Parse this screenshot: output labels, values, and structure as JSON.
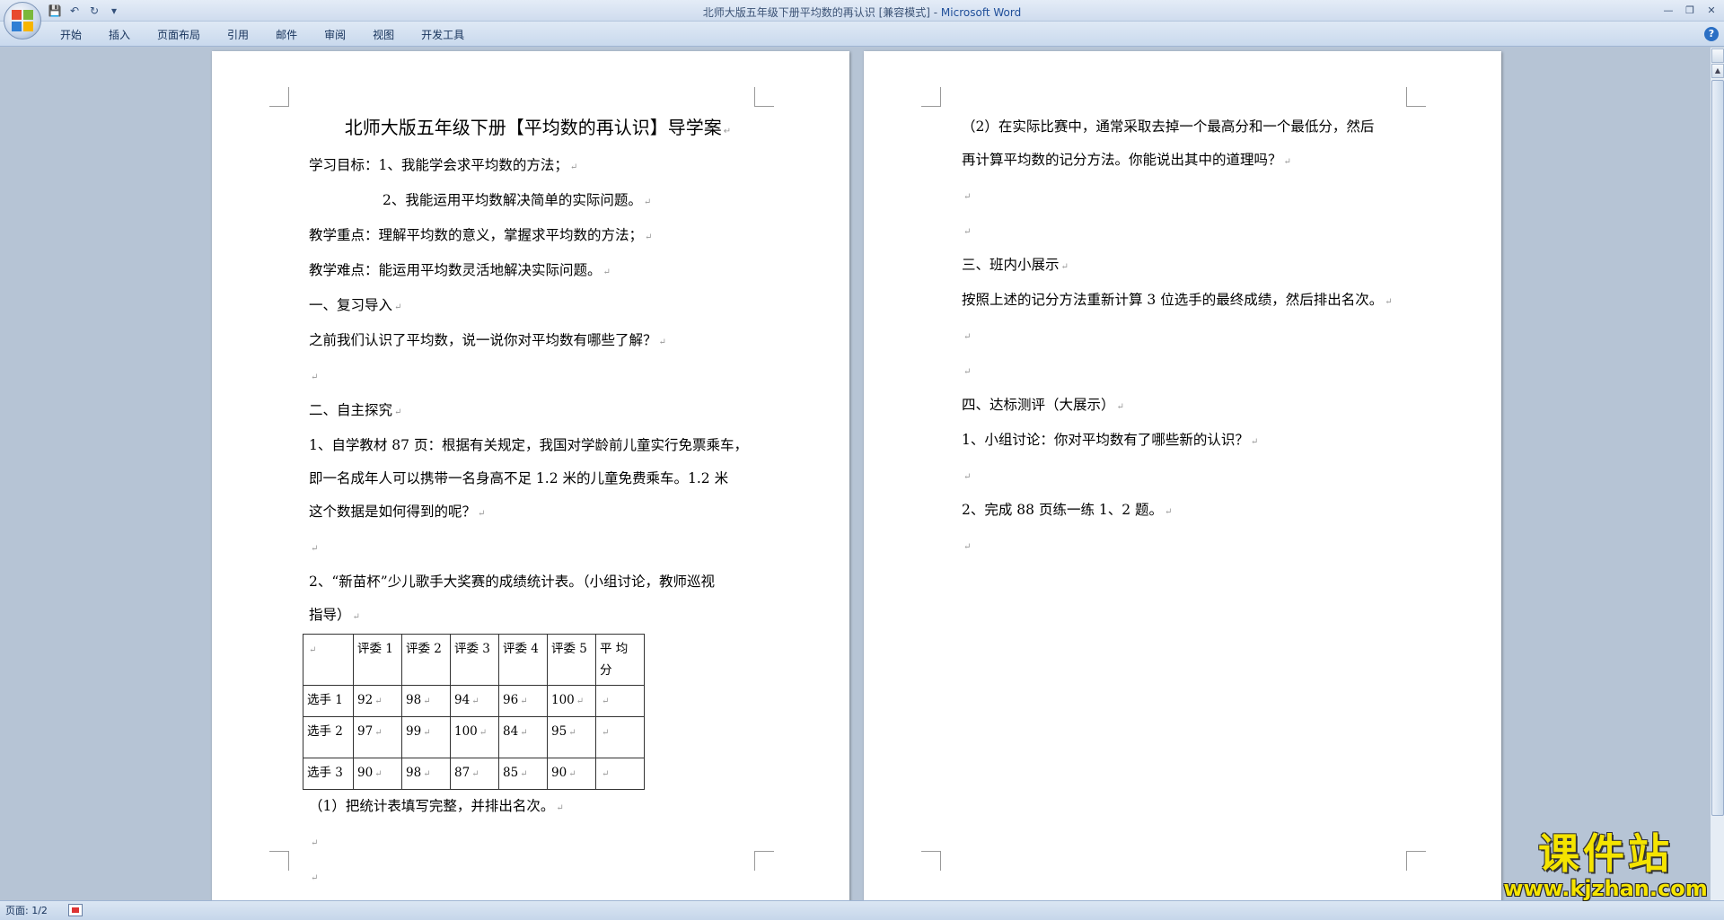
{
  "window": {
    "title": "北师大版五年级下册平均数的再认识 [兼容模式] - ",
    "app_name": "Microsoft Word"
  },
  "qat": {
    "save_icon": "💾",
    "undo_icon": "↶",
    "redo_icon": "↻",
    "more_icon": "▾"
  },
  "window_controls": {
    "minimize": "—",
    "restore": "❐",
    "close": "✕"
  },
  "ribbon": {
    "tabs": [
      "开始",
      "插入",
      "页面布局",
      "引用",
      "邮件",
      "审阅",
      "视图",
      "开发工具"
    ],
    "help": "?"
  },
  "page1": {
    "title": "北师大版五年级下册【平均数的再认识】导学案",
    "lines": [
      "学习目标：1、我能学会求平均数的方法；",
      "2、我能运用平均数解决简单的实际问题。",
      "教学重点：理解平均数的意义，掌握求平均数的方法；",
      "教学难点：能运用平均数灵活地解决实际问题。",
      "一、复习导入",
      "之前我们认识了平均数，说一说你对平均数有哪些了解？",
      "",
      "二、自主探究",
      "1、自学教材 87 页：根据有关规定，我国对学龄前儿童实行免票乘车，",
      "即一名成年人可以携带一名身高不足 1.2 米的儿童免费乘车。1.2 米",
      "这个数据是如何得到的呢？",
      "",
      "2、“新苗杯”少儿歌手大奖赛的成绩统计表。（小组讨论，教师巡视",
      "指导）"
    ],
    "table": {
      "header": [
        "",
        "评委 1",
        "评委 2",
        "评委 3",
        "评委 4",
        "评委 5",
        "平 均 分"
      ],
      "rows": [
        [
          "选手 1",
          "92",
          "98",
          "94",
          "96",
          "100",
          ""
        ],
        [
          "选手 2",
          "97",
          "99",
          "100",
          "84",
          "95",
          ""
        ],
        [
          "选手 3",
          "90",
          "98",
          "87",
          "85",
          "90",
          ""
        ]
      ]
    },
    "after_table": [
      "（1）把统计表填写完整，并排出名次。",
      "",
      ""
    ]
  },
  "page2": {
    "lines": [
      "（2）在实际比赛中，通常采取去掉一个最高分和一个最低分，然后",
      "再计算平均数的记分方法。你能说出其中的道理吗？",
      "",
      "",
      "三、班内小展示",
      "按照上述的记分方法重新计算 3 位选手的最终成绩，然后排出名次。",
      "",
      "",
      "四、达标测评（大展示）",
      "1、小组讨论：你对平均数有了哪些新的认识？",
      "",
      "2、完成 88 页练一练 1、2 题。",
      ""
    ]
  },
  "status": {
    "page": "页面: 1/2"
  },
  "watermark": {
    "text": "课件站",
    "url": "www.kjzhan.com"
  },
  "paragraph_mark": "↵"
}
